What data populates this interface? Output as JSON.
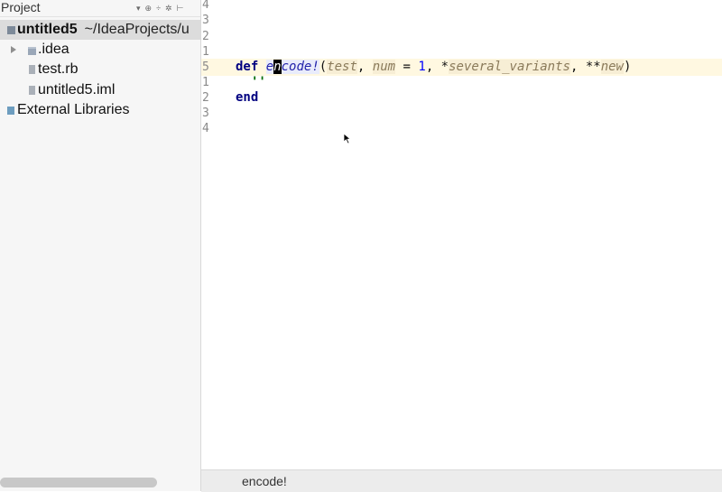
{
  "project_panel": {
    "title": "Project",
    "header_icons": [
      "dropdown-icon",
      "settings-sync-icon",
      "collapse-icon",
      "gear-icon",
      "hide-icon"
    ],
    "tree": [
      {
        "label": "untitled5",
        "path": "~/IdeaProjects/u",
        "icon": "project-icon"
      },
      {
        "label": ".idea",
        "icon": "folder-icon",
        "expandable": true
      },
      {
        "label": "test.rb",
        "icon": "ruby-file-icon"
      },
      {
        "label": "untitled5.iml",
        "icon": "iml-file-icon"
      },
      {
        "label": "External Libraries",
        "icon": "library-icon"
      }
    ]
  },
  "editor": {
    "line_numbers": [
      "4",
      "3",
      "2",
      "1",
      "5",
      "1",
      "2",
      "3",
      "4"
    ],
    "code": {
      "def_kw": "def",
      "method_pre": "e",
      "method_caret": "n",
      "method_post": "code!",
      "open_paren": "(",
      "p1": "test",
      "comma1": ", ",
      "p2": "num",
      "eq": " = ",
      "default_val": "1",
      "comma2": ", *",
      "p3": "several_variants",
      "comma3": ", **",
      "p4": "new",
      "close_paren": ")",
      "string_line": "''",
      "end_kw": "end"
    }
  },
  "status_bar": {
    "text": "encode!"
  }
}
